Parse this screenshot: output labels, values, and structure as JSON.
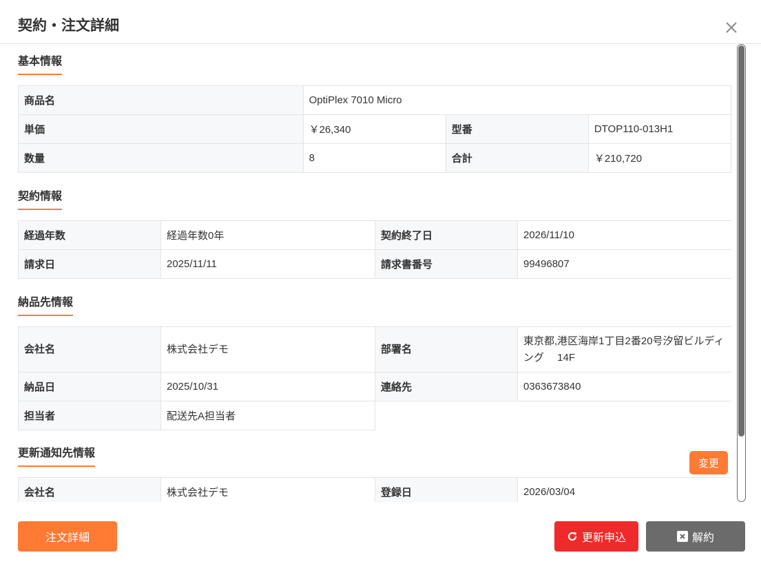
{
  "dialog": {
    "title": "契約・注文詳細",
    "close_icon": "close-icon"
  },
  "sections": {
    "basic": {
      "title": "基本情報",
      "product_name_label": "商品名",
      "product_name_value": "OptiPlex 7010 Micro",
      "unit_price_label": "単価",
      "unit_price_value": "￥26,340",
      "model_label": "型番",
      "model_value": "DTOP110-013H1",
      "quantity_label": "数量",
      "quantity_value": "8",
      "total_label": "合計",
      "total_value": "￥210,720"
    },
    "contract": {
      "title": "契約情報",
      "elapsed_label": "経過年数",
      "elapsed_value": "経過年数0年",
      "end_date_label": "契約終了日",
      "end_date_value": "2026/11/10",
      "billing_date_label": "請求日",
      "billing_date_value": "2025/11/11",
      "invoice_no_label": "請求書番号",
      "invoice_no_value": "99496807"
    },
    "delivery": {
      "title": "納品先情報",
      "company_label": "会社名",
      "company_value": "株式会社デモ",
      "department_label": "部署名",
      "department_value": "東京都,港区海岸1丁目2番20号汐留ビルディング　 14F",
      "delivery_date_label": "納品日",
      "delivery_date_value": "2025/10/31",
      "contact_label": "連絡先",
      "contact_value": "0363673840",
      "person_label": "担当者",
      "person_value": "配送先A担当者"
    },
    "renewal": {
      "title": "更新通知先情報",
      "change_button": "変更",
      "company_label": "会社名",
      "company_value": "株式会社デモ",
      "registered_label": "登録日",
      "registered_value": "2026/03/04"
    }
  },
  "footer": {
    "order_detail_button": "注文詳細",
    "renew_button": "更新申込",
    "renew_icon": "refresh-icon",
    "cancel_button": "解約",
    "cancel_icon": "close-square-icon"
  },
  "colors": {
    "accent": "#ff7a33",
    "renew": "#f02a2a",
    "cancel": "#6b6b6b",
    "label_bg": "#f7f8fa",
    "border": "#e4e4e4"
  }
}
